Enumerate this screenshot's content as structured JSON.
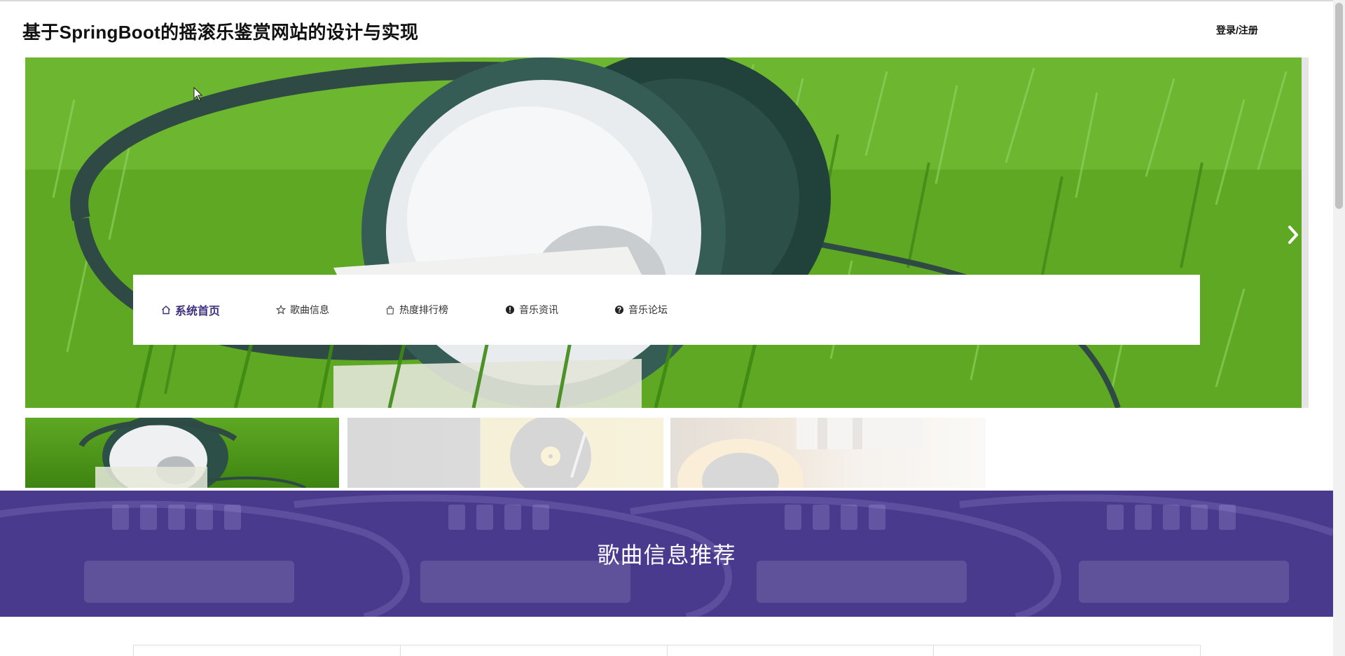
{
  "header": {
    "site_title": "基于SpringBoot的摇滚乐鉴赏网站的设计与实现",
    "login_label": "登录/注册"
  },
  "nav": {
    "items": [
      {
        "label": "系统首页",
        "icon": "home-icon",
        "active": true
      },
      {
        "label": "歌曲信息",
        "icon": "star-icon",
        "active": false
      },
      {
        "label": "热度排行榜",
        "icon": "bag-icon",
        "active": false
      },
      {
        "label": "音乐资讯",
        "icon": "exclamation-circle-icon",
        "active": false
      },
      {
        "label": "音乐论坛",
        "icon": "question-circle-icon",
        "active": false
      }
    ]
  },
  "carousel": {
    "active_index": 0,
    "slide_count": 3,
    "next_icon": "chevron-right-icon"
  },
  "section": {
    "title": "歌曲信息推荐"
  },
  "colors": {
    "accent": "#3d2f7e",
    "banner": "#4a3a8e"
  }
}
